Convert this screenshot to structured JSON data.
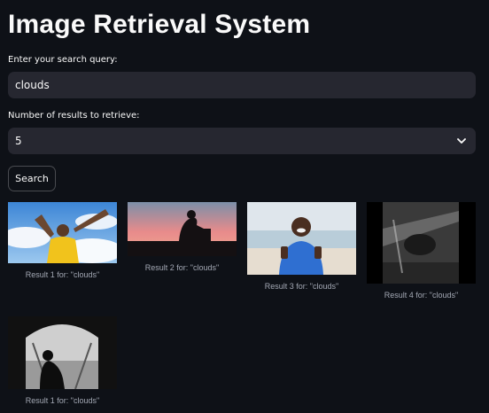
{
  "app": {
    "title": "Image Retrieval System"
  },
  "query": {
    "label": "Enter your search query:",
    "value": "clouds"
  },
  "num_results": {
    "label": "Number of results to retrieve:",
    "value": "5"
  },
  "search_button": {
    "label": "Search"
  },
  "results": [
    {
      "caption": "Result 1 for: \"clouds\"",
      "image": "woman-arms-raised-sky"
    },
    {
      "caption": "Result 2 for: \"clouds\"",
      "image": "silhouette-person-sunset"
    },
    {
      "caption": "Result 3 for: \"clouds\"",
      "image": "man-thumbs-up-beach"
    },
    {
      "caption": "Result 4 for: \"clouds\"",
      "image": "dark-blurry-night-photo"
    },
    {
      "caption": "Result 1 for: \"clouds\"",
      "image": "person-sitting-bw-doorway"
    }
  ],
  "colors": {
    "background": "#0e1117",
    "input_background": "#262730",
    "text": "#fafafa",
    "caption": "#a3a8b4"
  }
}
